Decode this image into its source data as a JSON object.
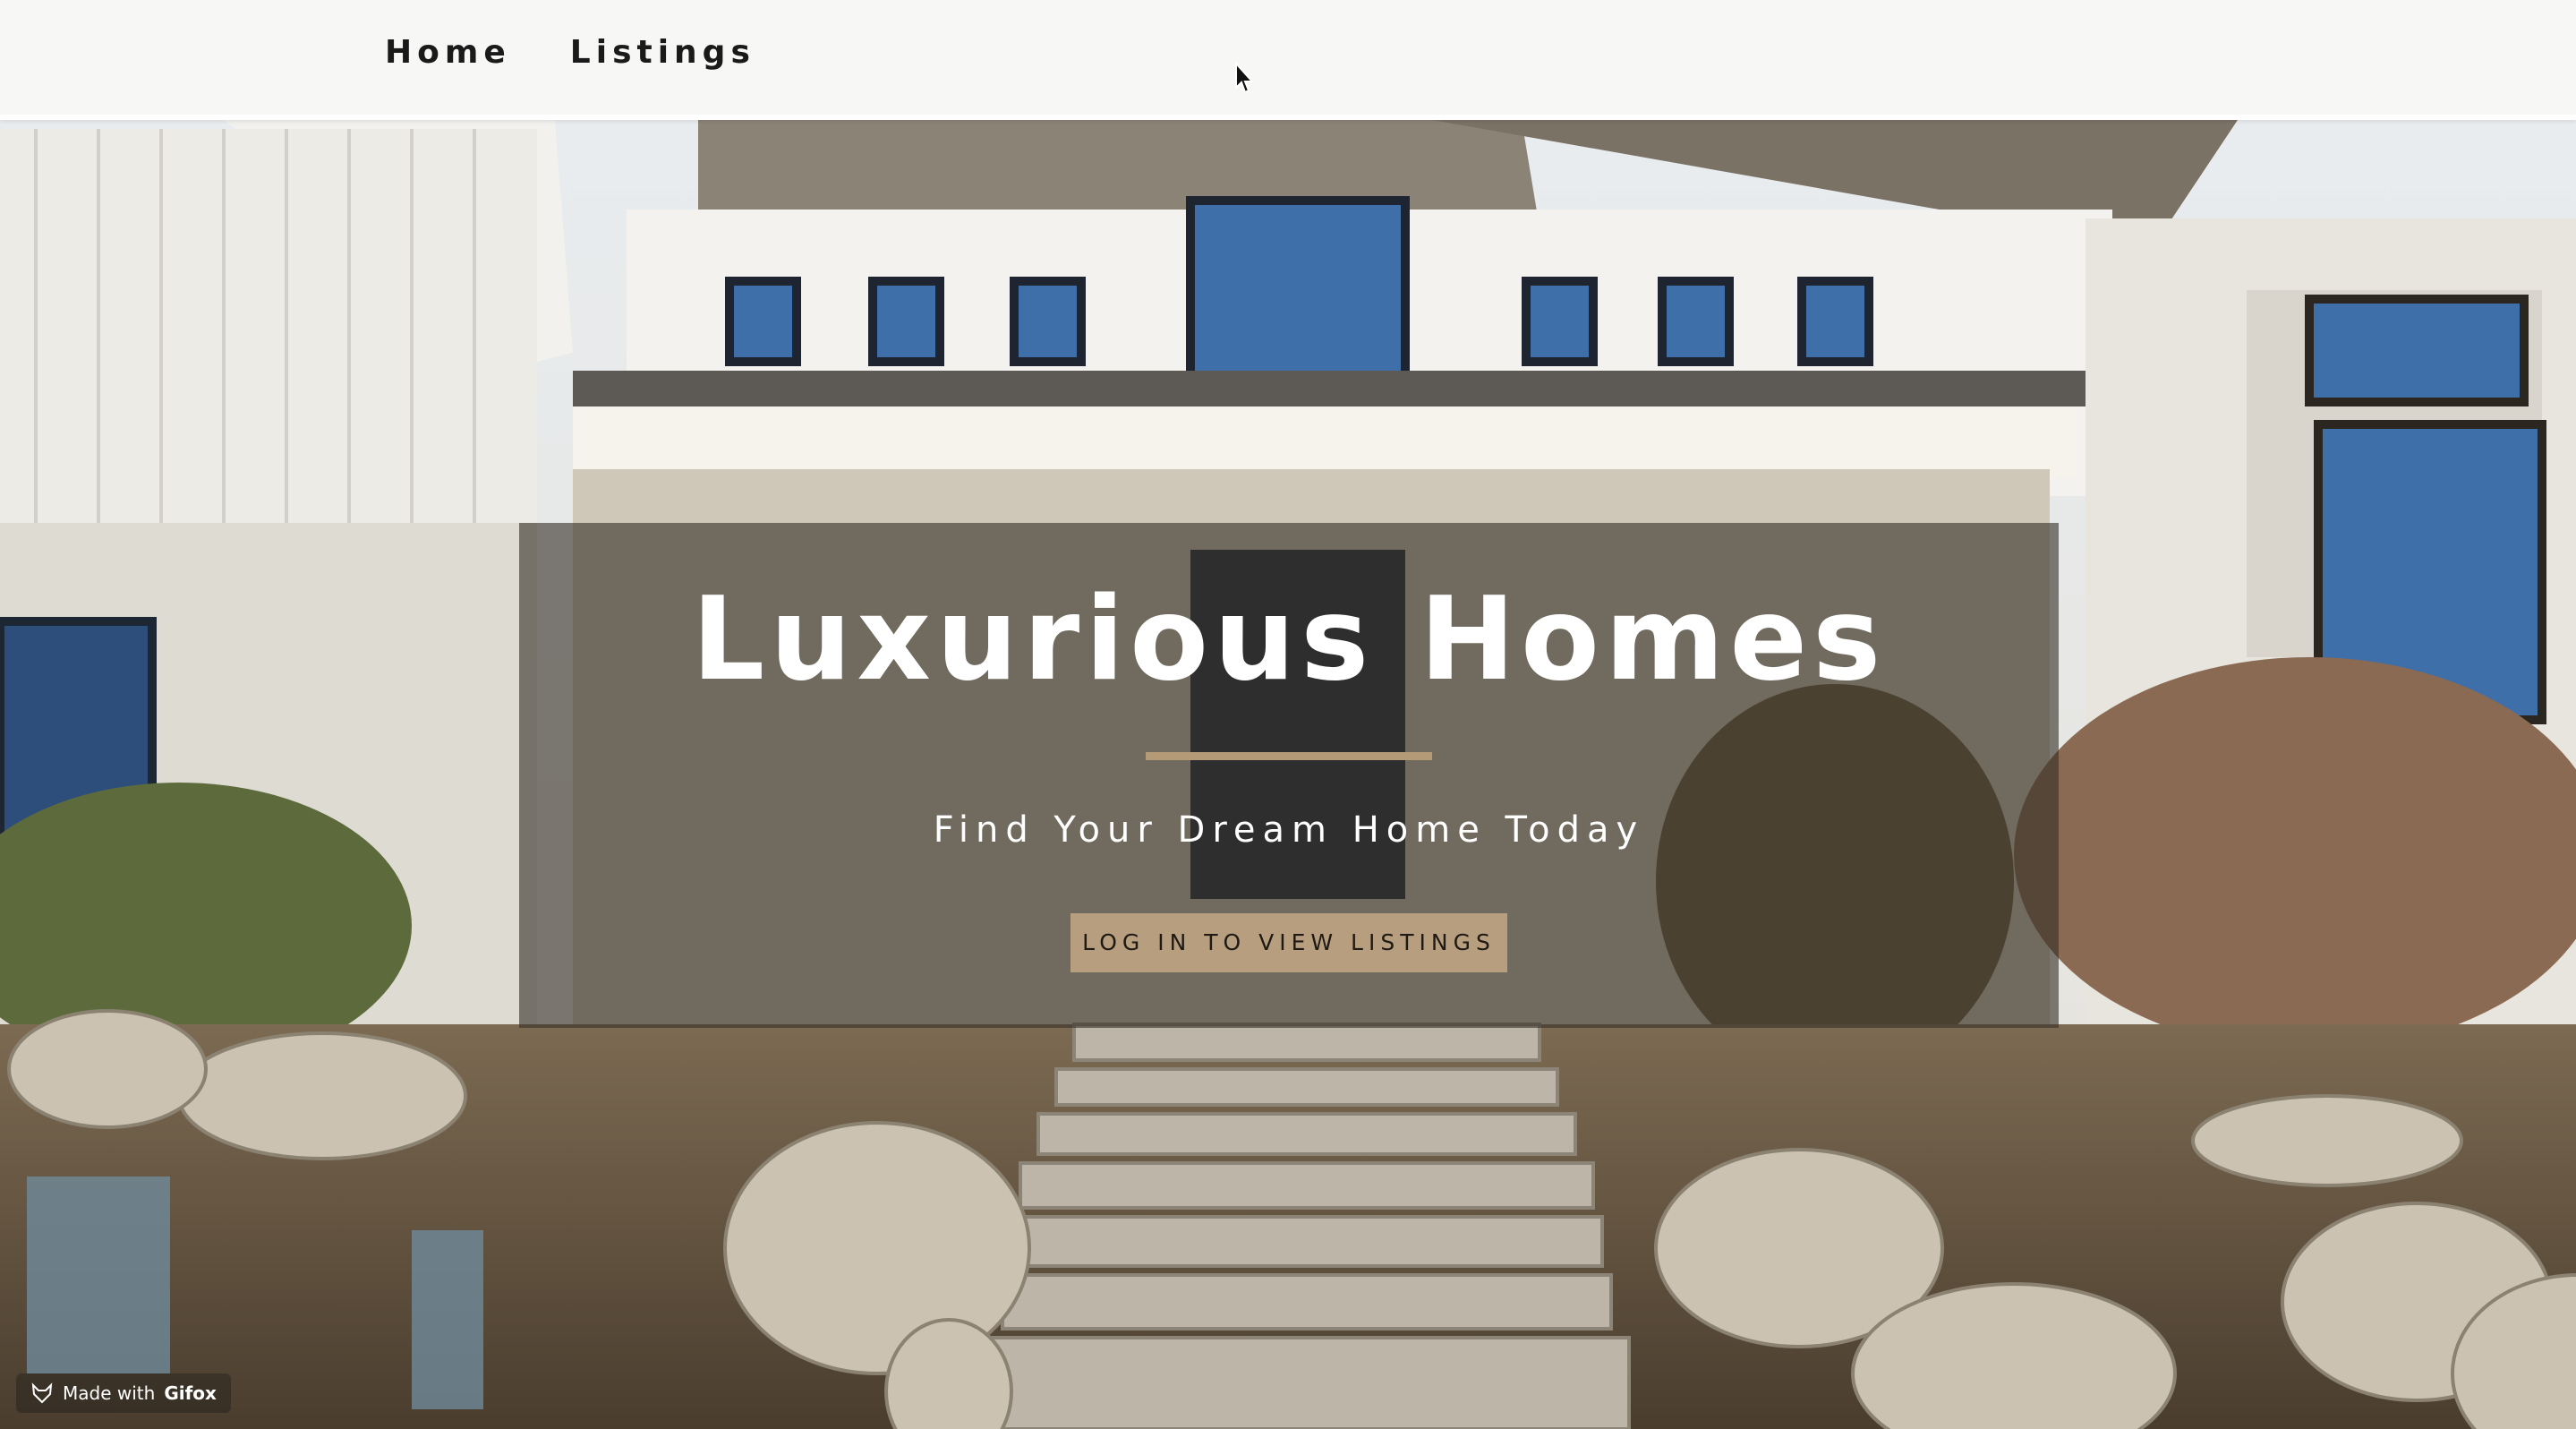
{
  "nav": {
    "items": [
      {
        "label": "Home"
      },
      {
        "label": "Listings"
      }
    ]
  },
  "hero": {
    "title": "Luxurious Homes",
    "subtitle": "Find Your Dream Home Today",
    "cta_label": "LOG IN TO VIEW LISTINGS",
    "image_icon": "house-photo"
  },
  "badge": {
    "prefix": "Made with",
    "brand": "Gifox",
    "icon": "gifox-fox-icon"
  },
  "colors": {
    "accent": "#b59a77",
    "button": "#b79e7f",
    "nav_bg": "#f7f7f5",
    "overlay": "#37302a"
  }
}
